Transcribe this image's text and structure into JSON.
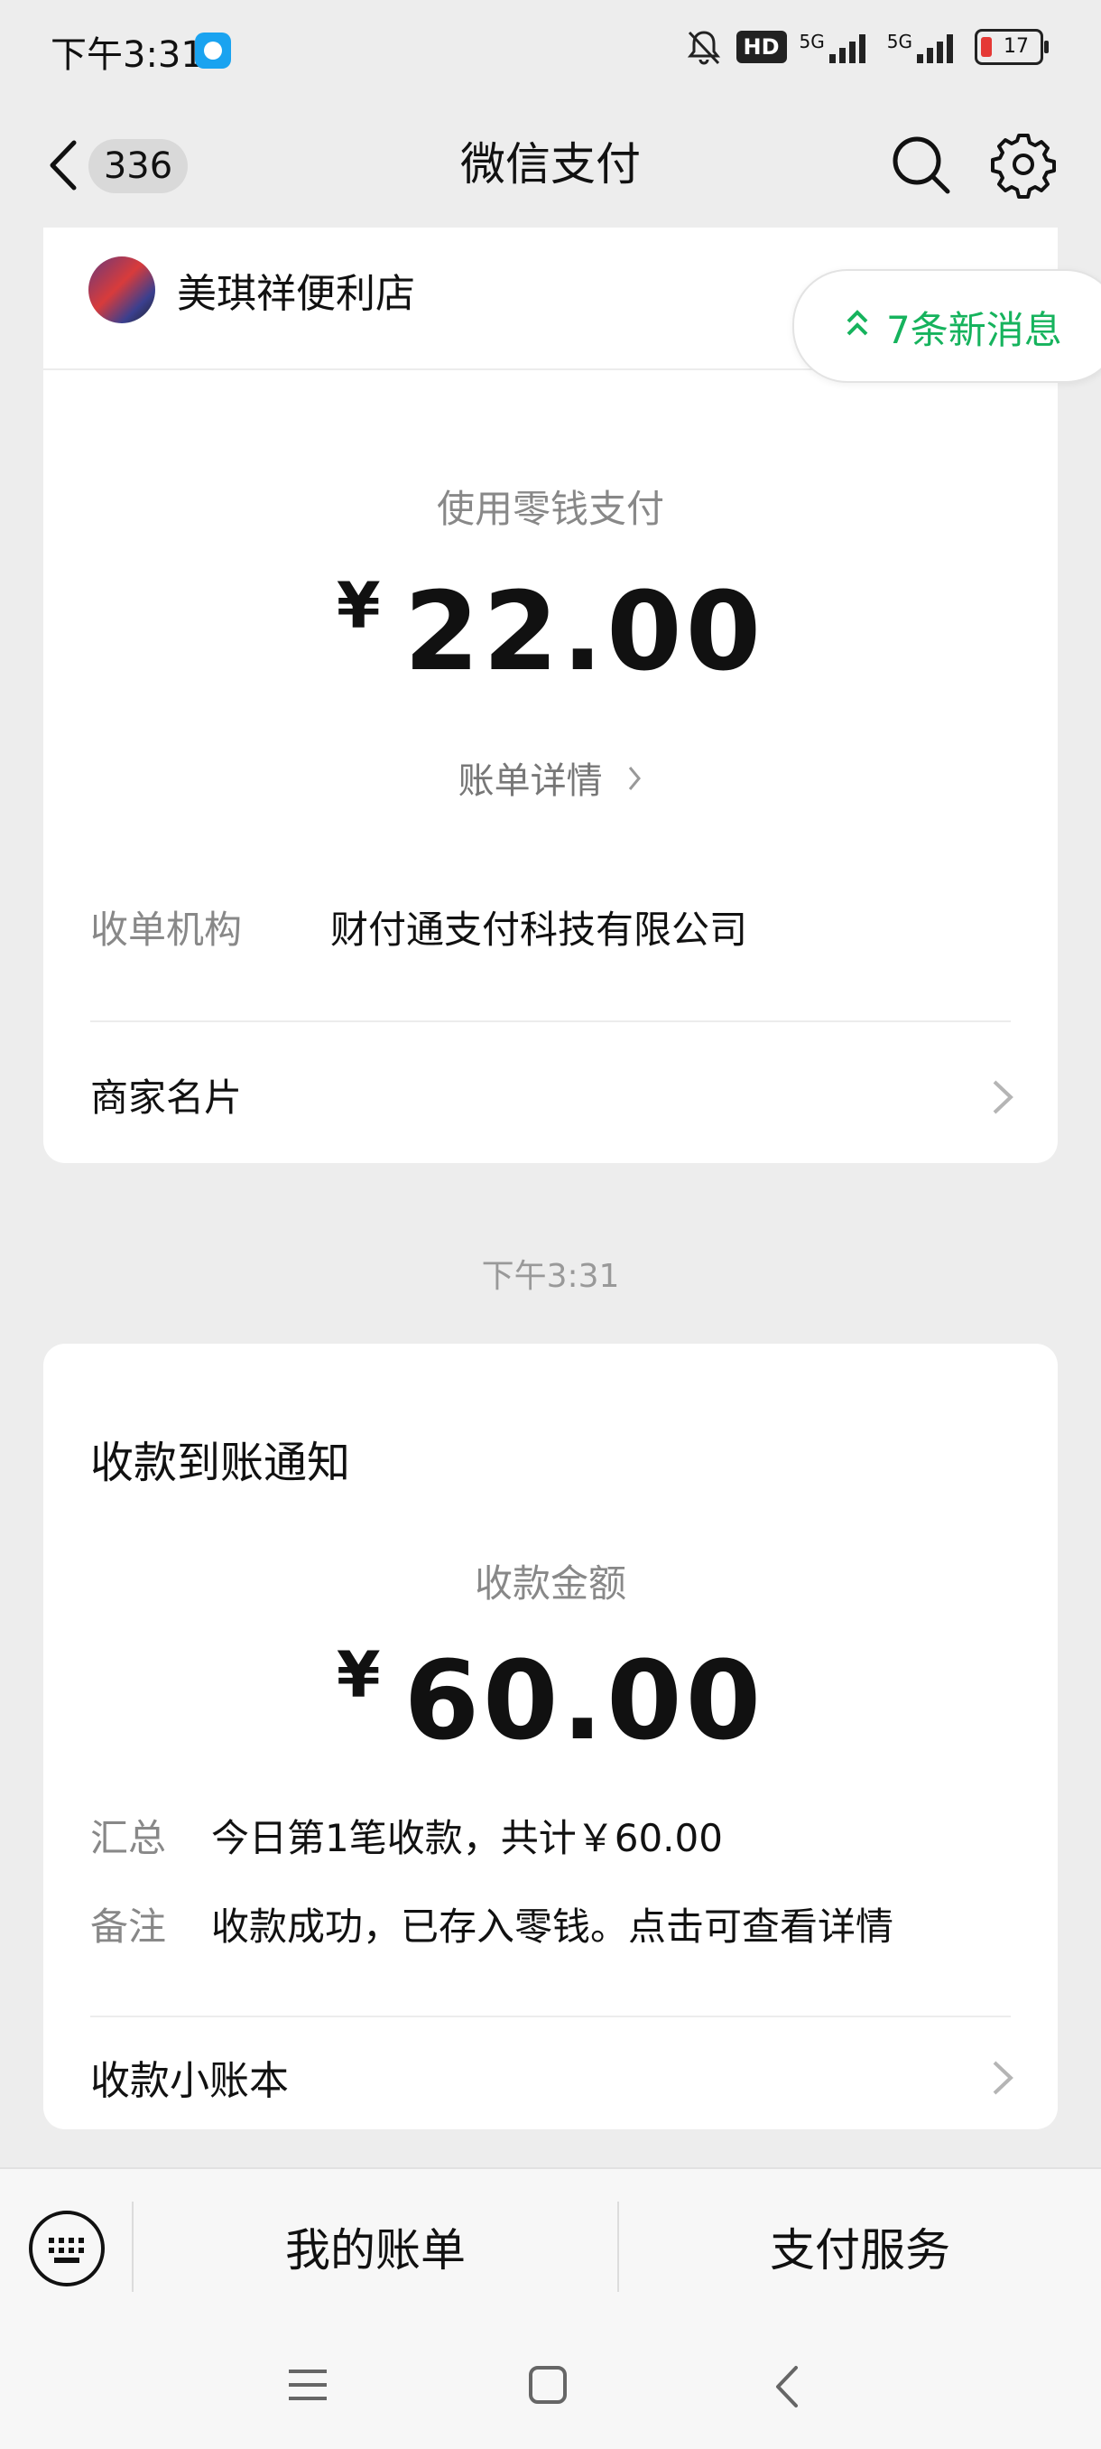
{
  "status_bar": {
    "time": "下午3:31",
    "hd_label": "HD",
    "net1": "5G",
    "net2": "5G",
    "battery": "17"
  },
  "nav": {
    "unread_count": "336",
    "title": "微信支付"
  },
  "payment_card": {
    "merchant_name": "美琪祥便利店",
    "pay_method": "使用零钱支付",
    "currency": "¥",
    "amount": "22.00",
    "bill_detail_link": "账单详情",
    "acquirer_label": "收单机构",
    "acquirer_value": "财付通支付科技有限公司",
    "merchant_card_label": "商家名片"
  },
  "new_messages": "7条新消息",
  "timestamp": "下午3:31",
  "receipt_card": {
    "title": "收款到账通知",
    "amount_label": "收款金额",
    "currency": "¥",
    "amount": "60.00",
    "summary_label": "汇总",
    "summary_value": "今日第1笔收款，共计￥60.00",
    "note_label": "备注",
    "note_value": "收款成功，已存入零钱。点击可查看详情",
    "ledger_label": "收款小账本"
  },
  "toolbar": {
    "my_bills": "我的账单",
    "pay_service": "支付服务"
  },
  "icons": {
    "status_mute": "bell-off-icon",
    "back": "chevron-left-icon",
    "search": "search-icon",
    "settings": "gear-icon",
    "keyboard": "keyboard-icon",
    "sys_menu": "menu-icon",
    "sys_home": "square-home-icon",
    "sys_back": "triangle-back-icon"
  },
  "colors": {
    "accent_green": "#16b35d",
    "battery_red": "#e53935"
  }
}
